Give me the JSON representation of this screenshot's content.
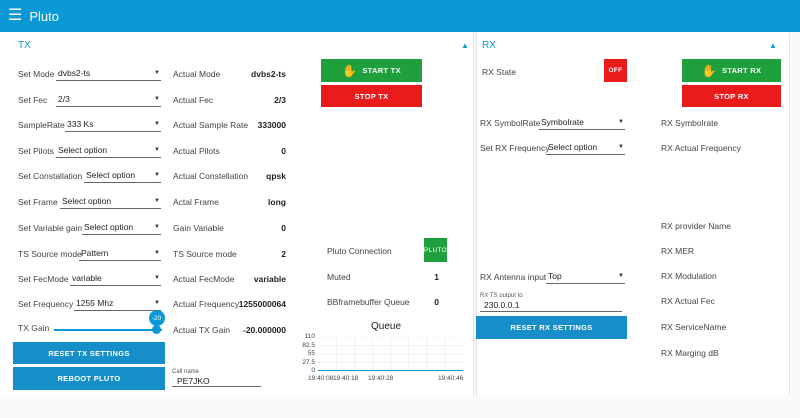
{
  "app": {
    "title": "Pluto"
  },
  "tx": {
    "header": "TX",
    "settings": [
      {
        "label": "Set Mode",
        "value": "dvbs2-ts"
      },
      {
        "label": "Set Fec",
        "value": "2/3"
      },
      {
        "label": "SampleRate",
        "value": "333 Ks"
      },
      {
        "label": "Set Pilots",
        "value": "Select option"
      },
      {
        "label": "Set Constallation",
        "value": "Select option"
      },
      {
        "label": "Set Frame",
        "value": "Select option"
      },
      {
        "label": "Set Variable gain",
        "value": "Select option"
      },
      {
        "label": "TS Source mode",
        "value": "Pattern"
      },
      {
        "label": "Set FecMode",
        "value": "variable"
      },
      {
        "label": "Set Frequency",
        "value": "1255 Mhz"
      }
    ],
    "gain": {
      "label": "TX Gain",
      "value": "-20",
      "level": 0.95
    },
    "status": [
      {
        "label": "Actual Mode",
        "value": "dvbs2-ts"
      },
      {
        "label": "Actual Fec",
        "value": "2/3"
      },
      {
        "label": "Actual Sample Rate",
        "value": "333000"
      },
      {
        "label": "Actual Pilots",
        "value": "0"
      },
      {
        "label": "Actual Constellation",
        "value": "qpsk"
      },
      {
        "label": "Actal Frame",
        "value": "long"
      },
      {
        "label": "Gain Variable",
        "value": "0"
      },
      {
        "label": "TS Source mode",
        "value": "2"
      },
      {
        "label": "Actual FecMode",
        "value": "variable"
      },
      {
        "label": "Actual Frequency",
        "value": "1255000064"
      },
      {
        "label": "Actual TX Gain",
        "value": "-20.000000"
      }
    ],
    "start_label": "START TX",
    "stop_label": "STOP TX",
    "reset_label": "RESET TX SETTINGS",
    "reboot_label": "REBOOT PLUTO",
    "callname": {
      "label": "Call name",
      "value": "PE7JKO"
    }
  },
  "pluto": {
    "connection_label": "Pluto Connection",
    "connection_badge": "PLUTO",
    "muted_label": "Muted",
    "muted_value": "1",
    "bbframe_label": "BBframebuffer Queue",
    "bbframe_value": "0"
  },
  "queue_chart": {
    "title": "Queue",
    "y_ticks": [
      "110",
      "82.5",
      "55",
      "27.5",
      "0"
    ],
    "x_ticks": [
      "19:40:08",
      "19:40:18",
      "19:40:28",
      "19:40:46"
    ]
  },
  "chart_data": {
    "type": "line",
    "title": "Queue",
    "x": [
      "19:40:08",
      "19:40:18",
      "19:40:28",
      "19:40:46"
    ],
    "series": [
      {
        "values": [
          0,
          0,
          0,
          0
        ]
      }
    ],
    "ylim": [
      0,
      110
    ]
  },
  "rx": {
    "header": "RX",
    "state_label": "RX State",
    "state_value": "OFF",
    "start_label": "START RX",
    "stop_label": "STOP RX",
    "symbolrate": {
      "label": "RX SymbolRate",
      "value": "Symbolrate"
    },
    "frequency": {
      "label": "Set RX Frequency",
      "value": "Select option"
    },
    "antenna": {
      "label": "RX Antenna input",
      "value": "Top"
    },
    "ts_output": {
      "label": "RX TS output to",
      "value": "230.0.0.1"
    },
    "reset_label": "RESET RX SETTINGS",
    "status_labels": [
      "RX Symbolrate",
      "RX Actual Frequency",
      "RX provider Name",
      "RX MER",
      "RX Modulation",
      "RX Actual Fec",
      "RX ServiceName",
      "RX Marging dB"
    ]
  },
  "colors": {
    "accent": "#0b98d6",
    "start": "#20a03c",
    "stop": "#ea1b1b",
    "action": "#168ec9"
  }
}
